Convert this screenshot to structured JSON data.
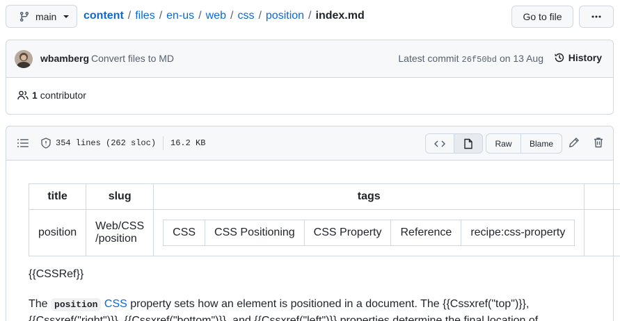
{
  "repo_nav": {
    "branch": "main",
    "breadcrumb": [
      "content",
      "files",
      "en-us",
      "web",
      "css",
      "position"
    ],
    "current_file": "index.md",
    "go_to_file_label": "Go to file"
  },
  "commit": {
    "author": "wbamberg",
    "message": "Convert files to MD",
    "latest_label": "Latest commit",
    "sha": "26f50bd",
    "date": "on 13 Aug",
    "history_label": "History"
  },
  "contributors": {
    "count": "1",
    "label": "contributor"
  },
  "file_header": {
    "lines": "354 lines (262 sloc)",
    "size": "16.2 KB",
    "raw_label": "Raw",
    "blame_label": "Blame"
  },
  "frontmatter": {
    "headers": [
      "title",
      "slug",
      "tags"
    ],
    "title": "position",
    "slug_line1": "Web/CSS",
    "slug_line2": "/position",
    "tags": [
      "CSS",
      "CSS Positioning",
      "CSS Property",
      "Reference",
      "recipe:css-property"
    ]
  },
  "body": {
    "cssref": "{{CSSRef}}",
    "p_the": "The",
    "p_code": "position",
    "p_link": "CSS",
    "p_rest1": "property sets how an element is positioned in a document. The {{Cssxref(\"top\")}},",
    "p_rest2": "{{Cssxref(\"right\")}}, {{Cssxref(\"bottom\")}}, and {{Cssxref(\"left\")}} properties determine the final location of"
  }
}
